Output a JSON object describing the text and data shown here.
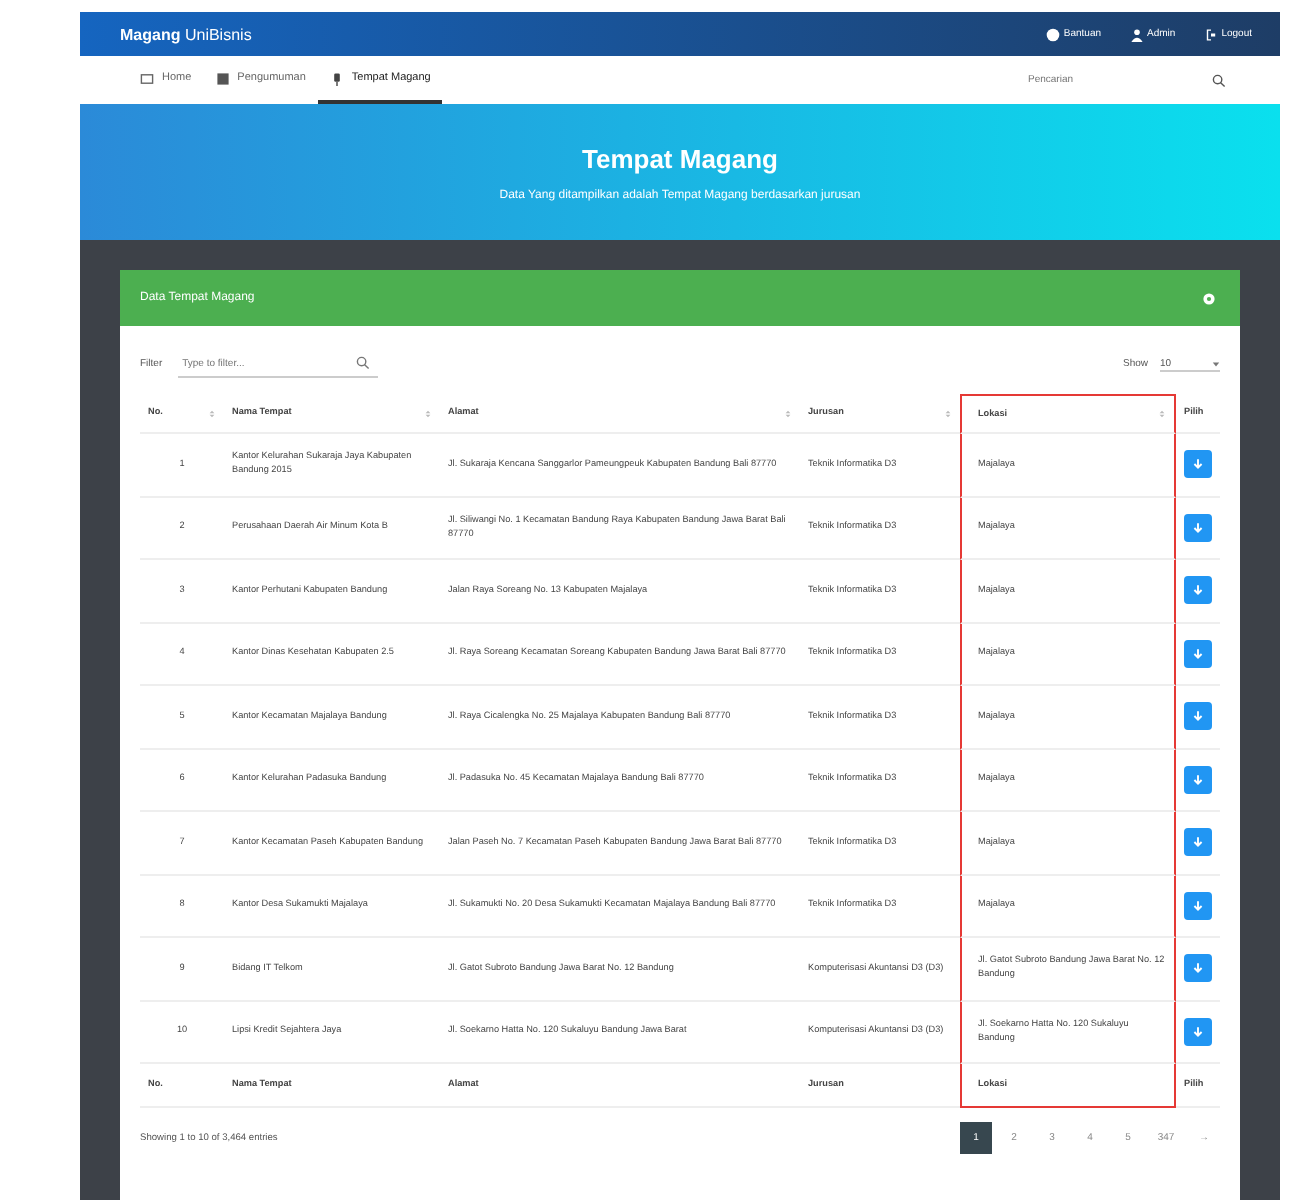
{
  "brand": {
    "name": "Magang",
    "suffix": "UniBisnis"
  },
  "top_links": [
    {
      "label": "Bantuan"
    },
    {
      "label": "Admin"
    },
    {
      "label": "Logout"
    }
  ],
  "tabs": [
    {
      "label": "Home",
      "selected": false
    },
    {
      "label": "Pengumuman",
      "selected": false
    },
    {
      "label": "Tempat Magang",
      "selected": true
    }
  ],
  "search": {
    "placeholder": "Pencarian"
  },
  "hero": {
    "title": "Tempat Magang",
    "subtitle": "Data Yang ditampilkan adalah Tempat Magang berdasarkan jurusan"
  },
  "card": {
    "title": "Data Tempat Magang"
  },
  "filter": {
    "label": "Filter",
    "placeholder": "Type to filter..."
  },
  "show": {
    "label": "Show",
    "value": "10"
  },
  "table": {
    "columns": [
      "No.",
      "Nama Tempat",
      "Alamat",
      "Jurusan",
      "Lokasi",
      "Pilih"
    ],
    "rows": [
      {
        "no": "1",
        "name": "Kantor Kelurahan Sukaraja Jaya Kabupaten Bandung 2015",
        "address": "Jl. Sukaraja Kencana Sanggarlor Pameungpeuk Kabupaten Bandung Bali 87770",
        "major": "Teknik Informatika D3",
        "location": "Majalaya"
      },
      {
        "no": "2",
        "name": "Perusahaan Daerah Air Minum Kota B",
        "address": "Jl. Siliwangi No. 1 Kecamatan Bandung Raya Kabupaten Bandung Jawa Barat Bali 87770",
        "major": "Teknik Informatika D3",
        "location": "Majalaya"
      },
      {
        "no": "3",
        "name": "Kantor Perhutani Kabupaten Bandung",
        "address": "Jalan Raya Soreang No. 13 Kabupaten Majalaya",
        "major": "Teknik Informatika D3",
        "location": "Majalaya"
      },
      {
        "no": "4",
        "name": "Kantor Dinas Kesehatan Kabupaten 2.5",
        "address": "Jl. Raya Soreang Kecamatan Soreang Kabupaten Bandung Jawa Barat Bali 87770",
        "major": "Teknik Informatika D3",
        "location": "Majalaya"
      },
      {
        "no": "5",
        "name": "Kantor Kecamatan Majalaya Bandung",
        "address": "Jl. Raya Cicalengka No. 25 Majalaya Kabupaten Bandung Bali 87770",
        "major": "Teknik Informatika D3",
        "location": "Majalaya"
      },
      {
        "no": "6",
        "name": "Kantor Kelurahan Padasuka Bandung",
        "address": "Jl. Padasuka No. 45 Kecamatan Majalaya Bandung Bali 87770",
        "major": "Teknik Informatika D3",
        "location": "Majalaya"
      },
      {
        "no": "7",
        "name": "Kantor Kecamatan Paseh Kabupaten Bandung",
        "address": "Jalan Paseh No. 7 Kecamatan Paseh Kabupaten Bandung Jawa Barat Bali 87770",
        "major": "Teknik Informatika D3",
        "location": "Majalaya"
      },
      {
        "no": "8",
        "name": "Kantor Desa Sukamukti Majalaya",
        "address": "Jl. Sukamukti No. 20 Desa Sukamukti Kecamatan Majalaya Bandung Bali 87770",
        "major": "Teknik Informatika D3",
        "location": "Majalaya"
      },
      {
        "no": "9",
        "name": "Bidang IT Telkom",
        "address": "Jl. Gatot Subroto Bandung Jawa Barat No. 12 Bandung",
        "major": "Komputerisasi Akuntansi D3 (D3)",
        "location": "Jl. Gatot Subroto Bandung Jawa Barat No. 12 Bandung"
      },
      {
        "no": "10",
        "name": "Lipsi Kredit Sejahtera Jaya",
        "address": "Jl. Soekarno Hatta No. 120 Sukaluyu Bandung Jawa Barat",
        "major": "Komputerisasi Akuntansi D3 (D3)",
        "location": "Jl. Soekarno Hatta No. 120 Sukaluyu Bandung"
      }
    ],
    "footer": [
      "No.",
      "Nama Tempat",
      "Alamat",
      "Jurusan",
      "Lokasi",
      "Pilih"
    ]
  },
  "info": "Showing 1 to 10 of 3,464 entries",
  "pages": [
    {
      "label": "1",
      "selected": true
    },
    {
      "label": "2",
      "selected": false
    },
    {
      "label": "3",
      "selected": false
    },
    {
      "label": "4",
      "selected": false
    },
    {
      "label": "5",
      "selected": false
    },
    {
      "label": "347",
      "selected": false
    }
  ],
  "next": "→"
}
